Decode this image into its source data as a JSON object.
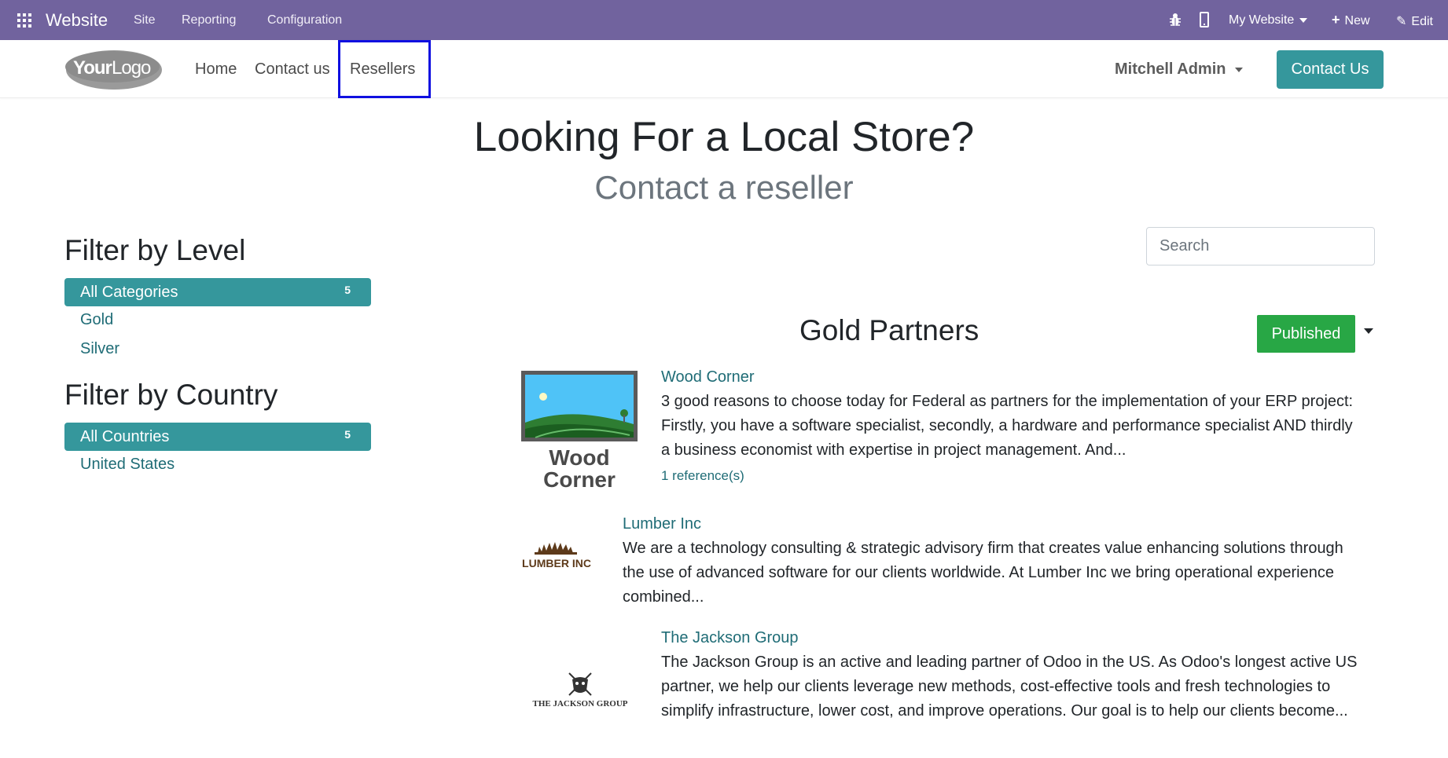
{
  "topbar": {
    "app_name": "Website",
    "menu": [
      "Site",
      "Reporting",
      "Configuration"
    ],
    "site_select": "My Website",
    "new_label": "New",
    "edit_label": "Edit",
    "bg_color": "#71639e"
  },
  "header": {
    "logo_text_bold": "Your",
    "logo_text_light": "Logo",
    "nav": [
      "Home",
      "Contact us",
      "Resellers"
    ],
    "user": "Mitchell Admin",
    "contact_button": "Contact Us",
    "accent_color": "#35979c"
  },
  "hero": {
    "title": "Looking For a Local Store?",
    "subtitle": "Contact a reseller"
  },
  "filters": {
    "level_heading": "Filter by Level",
    "levels": {
      "active": {
        "label": "All Categories",
        "count": "5"
      },
      "items": [
        "Gold",
        "Silver"
      ]
    },
    "country_heading": "Filter by Country",
    "countries": {
      "active": {
        "label": "All Countries",
        "count": "5"
      },
      "items": [
        "United States"
      ]
    }
  },
  "search": {
    "placeholder": "Search"
  },
  "partners": {
    "section_title": "Gold Partners",
    "published_label": "Published",
    "items": [
      {
        "name": "Wood Corner",
        "logo_text": [
          "Wood",
          "Corner"
        ],
        "lines": [
          "3 good reasons to choose today for Federal as partners for the implementation of your ERP project:",
          "Firstly, you have a software specialist, secondly, a hardware and performance specialist AND thirdly",
          "a business economist with expertise in project management. And..."
        ],
        "references": "1 reference(s)"
      },
      {
        "name": "Lumber Inc",
        "logo_text": "LUMBER INC",
        "lines": [
          "We are a technology consulting & strategic advisory firm that creates value enhancing solutions through",
          "the use of advanced software for our clients worldwide. At Lumber Inc we bring operational experience",
          "combined..."
        ]
      },
      {
        "name": "The Jackson Group",
        "logo_text": "THE JACKSON GROUP",
        "lines": [
          "The Jackson Group is an active and leading partner of Odoo in the US. As Odoo's longest active US",
          "partner, we help our clients leverage new methods, cost-effective tools and fresh technologies to",
          "simplify infrastructure, lower cost, and improve operations. Our goal is to help our clients become..."
        ]
      }
    ]
  }
}
